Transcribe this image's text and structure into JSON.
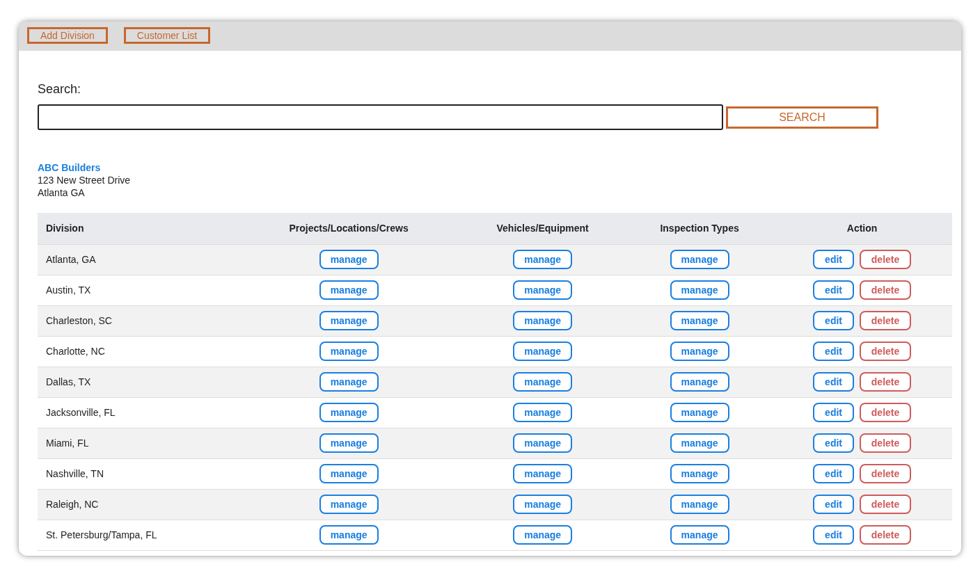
{
  "toolbar": {
    "buttons": [
      "Add Division",
      "Customer List"
    ]
  },
  "search": {
    "label": "Search:",
    "button": "SEARCH"
  },
  "customer": {
    "name": "ABC Builders",
    "address_line_1": "123 New Street Drive",
    "address_line_2": "Atlanta GA"
  },
  "table": {
    "columns": [
      "Division",
      "Projects/Locations/Crews",
      "Vehicles/Equipment",
      "Inspection Types",
      "Action"
    ],
    "rows": [
      {
        "division": "Atlanta, GA",
        "projects": "manage",
        "vehicles": "manage",
        "inspections": "manage",
        "edit": "edit",
        "delete": "delete"
      },
      {
        "division": "Austin, TX",
        "projects": "manage",
        "vehicles": "manage",
        "inspections": "manage",
        "edit": "edit",
        "delete": "delete"
      },
      {
        "division": "Charleston, SC",
        "projects": "manage",
        "vehicles": "manage",
        "inspections": "manage",
        "edit": "edit",
        "delete": "delete"
      },
      {
        "division": "Charlotte, NC",
        "projects": "manage",
        "vehicles": "manage",
        "inspections": "manage",
        "edit": "edit",
        "delete": "delete"
      },
      {
        "division": "Dallas, TX",
        "projects": "manage",
        "vehicles": "manage",
        "inspections": "manage",
        "edit": "edit",
        "delete": "delete"
      },
      {
        "division": "Jacksonville, FL",
        "projects": "manage",
        "vehicles": "manage",
        "inspections": "manage",
        "edit": "edit",
        "delete": "delete"
      },
      {
        "division": "Miami, FL",
        "projects": "manage",
        "vehicles": "manage",
        "inspections": "manage",
        "edit": "edit",
        "delete": "delete"
      },
      {
        "division": "Nashville, TN",
        "projects": "manage",
        "vehicles": "manage",
        "inspections": "manage",
        "edit": "edit",
        "delete": "delete"
      },
      {
        "division": "Raleigh, NC",
        "projects": "manage",
        "vehicles": "manage",
        "inspections": "manage",
        "edit": "edit",
        "delete": "delete"
      },
      {
        "division": "St. Petersburg/Tampa, FL",
        "projects": "manage",
        "vehicles": "manage",
        "inspections": "manage",
        "edit": "edit",
        "delete": "delete"
      }
    ]
  }
}
